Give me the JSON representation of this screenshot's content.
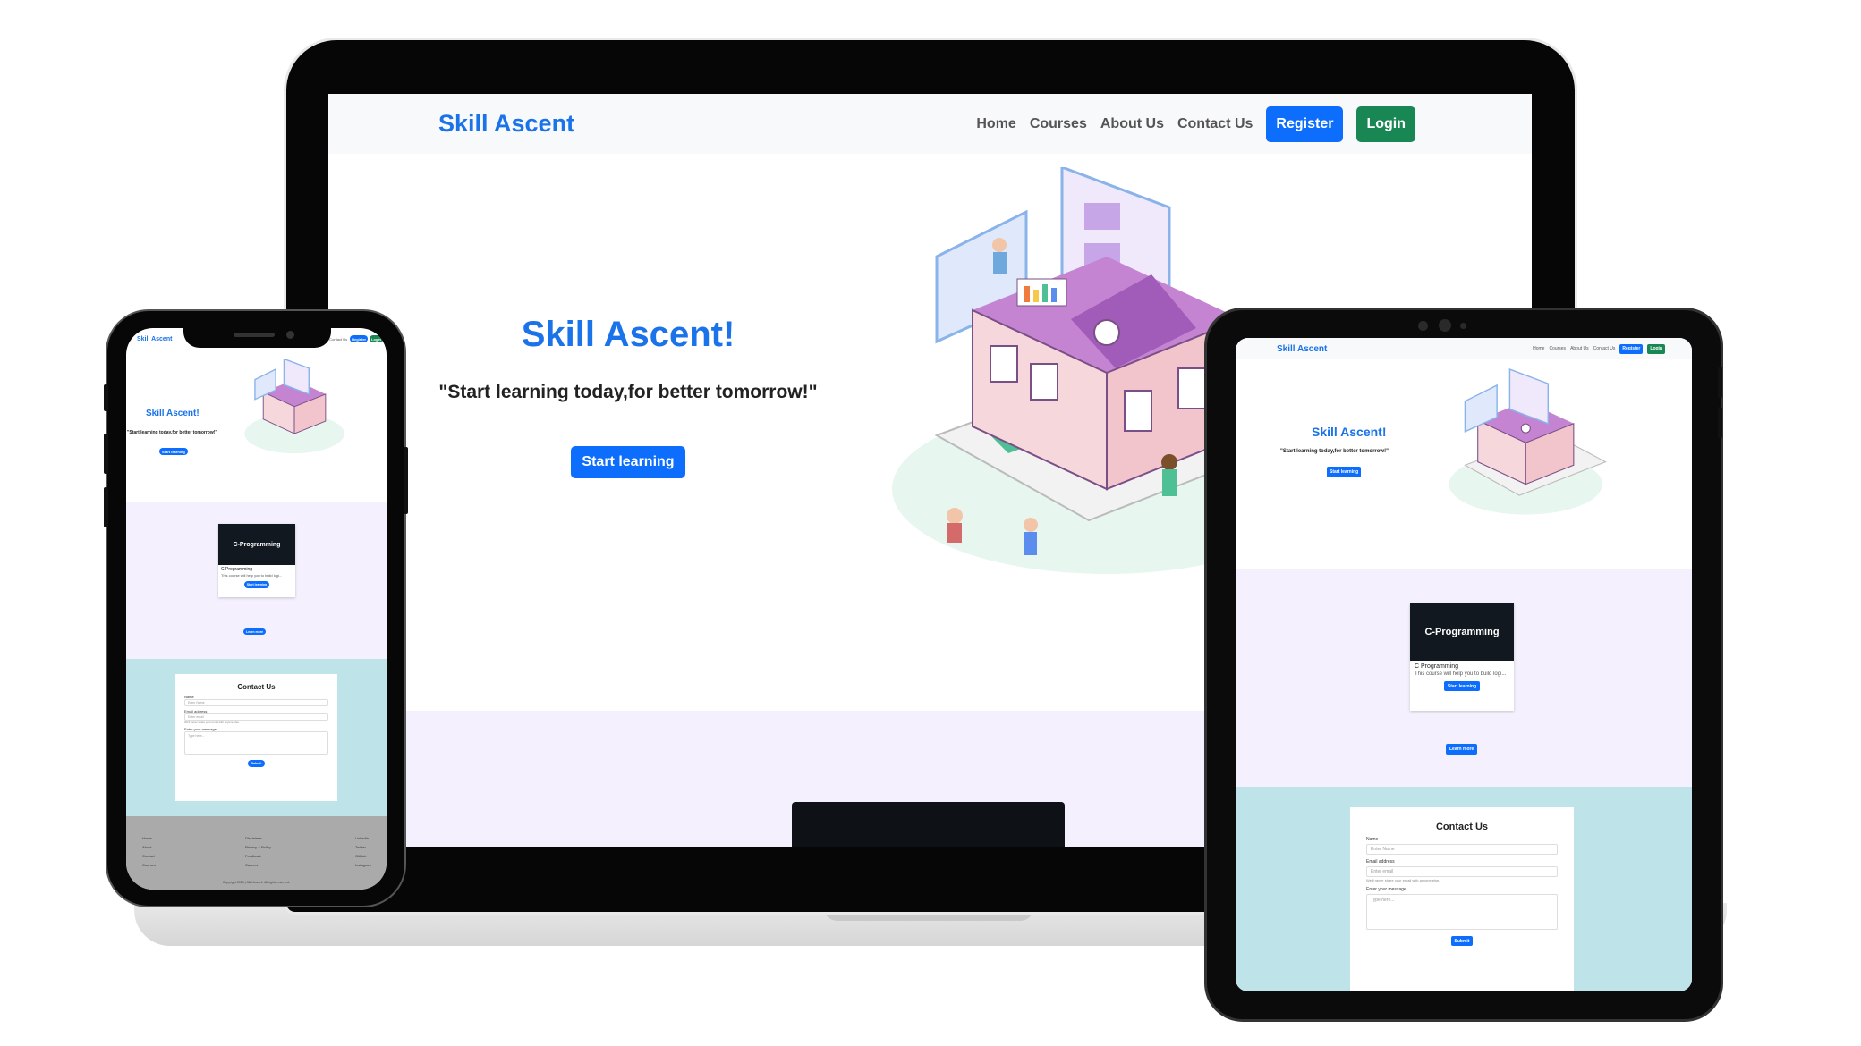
{
  "site": {
    "brand": "Skill Ascent",
    "nav_links": [
      "Home",
      "Courses",
      "About Us",
      "Contact Us"
    ],
    "register_label": "Register",
    "login_label": "Login"
  },
  "hero": {
    "title": "Skill Ascent!",
    "tagline": "\"Start learning today,for better tomorrow!\"",
    "button_label": "Start learning"
  },
  "course_card": {
    "image_text": "C-Programming",
    "title": "C Programming",
    "description": "This course will help you to build logi...",
    "button_label": "Start learning"
  },
  "courses_section": {
    "learn_more_label": "Learn more"
  },
  "contact": {
    "title": "Contact Us",
    "name_label": "Name",
    "name_placeholder": "Enter Name",
    "email_label": "Email address",
    "email_placeholder": "Enter email",
    "email_help": "We'll never share your email with anyone else.",
    "message_label": "Enter your message",
    "message_placeholder": "Type here...",
    "submit_label": "Submit"
  },
  "footer": {
    "col1": [
      "Home",
      "About",
      "Contact",
      "Courses"
    ],
    "col2": [
      "Disclaimer",
      "Privacy & Policy",
      "Feedback",
      "Careers"
    ],
    "col3": [
      "LinkedIn",
      "Twitter",
      "GitHub",
      "Instagram"
    ],
    "copyright": "Copyright 2023 | Skill Ascent. All rights reserved."
  },
  "colors": {
    "brand_blue": "#1a73e8",
    "button_blue": "#0d6efd",
    "button_green": "#198754",
    "courses_bg": "#f5f0fd",
    "contact_bg": "#bee3e8",
    "footer_bg": "#aaaaaa"
  }
}
